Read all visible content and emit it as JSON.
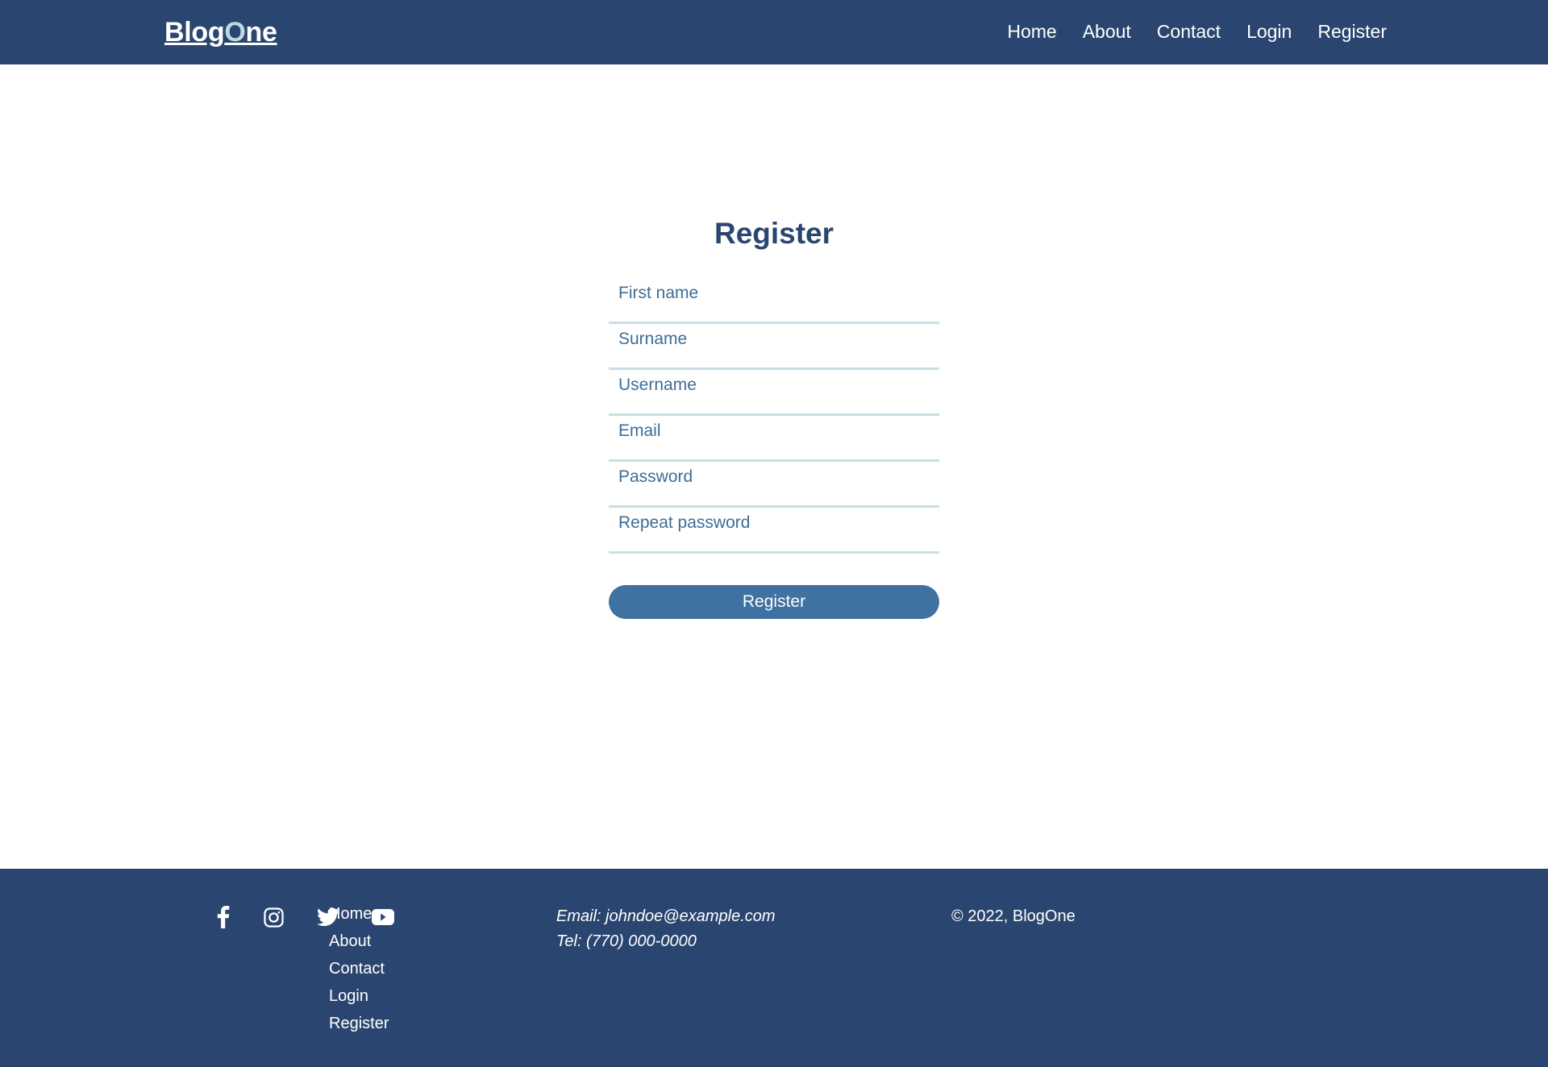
{
  "theme": {
    "navy": "#2a4670",
    "accent_light": "#bdd9e0",
    "field_underline": "#c7dfe5",
    "field_text": "#3d6d96",
    "button_bg": "#3f71a1",
    "page_bg": "#ffffff"
  },
  "header": {
    "brand_part1": "Blog",
    "brand_accent": "O",
    "brand_part2": "ne",
    "nav": [
      {
        "label": "Home",
        "name": "nav-link-home"
      },
      {
        "label": "About",
        "name": "nav-link-about"
      },
      {
        "label": "Contact",
        "name": "nav-link-contact"
      },
      {
        "label": "Login",
        "name": "nav-link-login"
      },
      {
        "label": "Register",
        "name": "nav-link-register"
      }
    ]
  },
  "main": {
    "title": "Register",
    "fields": [
      {
        "placeholder": "First name",
        "value": "",
        "type": "text",
        "name": "first-name-input"
      },
      {
        "placeholder": "Surname",
        "value": "",
        "type": "text",
        "name": "surname-input"
      },
      {
        "placeholder": "Username",
        "value": "",
        "type": "text",
        "name": "username-input"
      },
      {
        "placeholder": "Email",
        "value": "",
        "type": "email",
        "name": "email-input"
      },
      {
        "placeholder": "Password",
        "value": "",
        "type": "password",
        "name": "password-input"
      },
      {
        "placeholder": "Repeat password",
        "value": "",
        "type": "password",
        "name": "repeat-password-input"
      }
    ],
    "submit_label": "Register"
  },
  "footer": {
    "social": [
      {
        "icon": "facebook-icon",
        "label": "Facebook"
      },
      {
        "icon": "instagram-icon",
        "label": "Instagram"
      },
      {
        "icon": "twitter-icon",
        "label": "Twitter"
      },
      {
        "icon": "youtube-icon",
        "label": "YouTube"
      }
    ],
    "links": [
      {
        "label": "Home",
        "name": "footer-link-home"
      },
      {
        "label": "About",
        "name": "footer-link-about"
      },
      {
        "label": "Contact",
        "name": "footer-link-contact"
      },
      {
        "label": "Login",
        "name": "footer-link-login"
      },
      {
        "label": "Register",
        "name": "footer-link-register"
      }
    ],
    "contact": {
      "email_line": "Email: johndoe@example.com",
      "tel_line": "Tel: (770) 000-0000"
    },
    "copyright": "© 2022, BlogOne"
  }
}
